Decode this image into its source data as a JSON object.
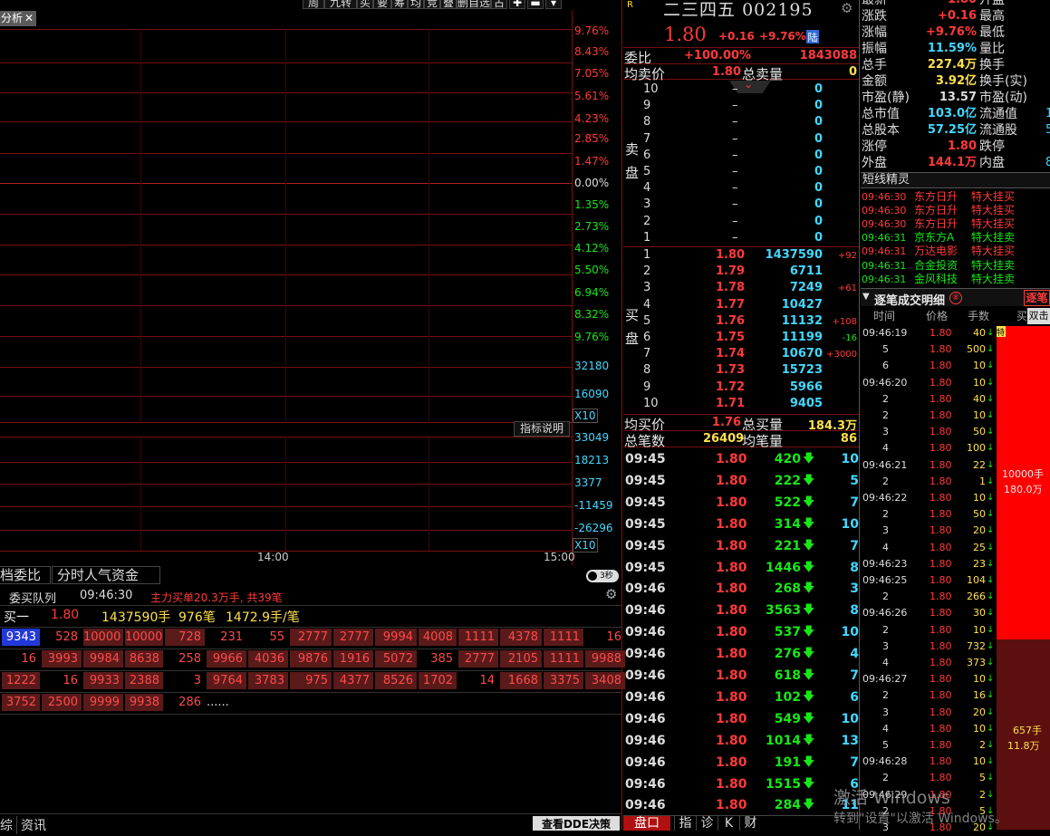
{
  "top_tabs": [
    "分析",
    "周",
    "九转",
    "买",
    "要",
    "筹",
    "均",
    "竞",
    "叠",
    "删自选",
    "占"
  ],
  "chart_tab": "分析",
  "pct_labels_red": [
    "9.76%",
    "8.43%",
    "7.05%",
    "5.61%",
    "4.23%",
    "2.85%",
    "1.47%"
  ],
  "pct_zero": "0.00%",
  "pct_labels_green": [
    "1.35%",
    "2.73%",
    "4.12%",
    "5.50%",
    "6.94%",
    "8.32%",
    "9.76%"
  ],
  "vol_labels": [
    "32180",
    "16090"
  ],
  "x10_a": "X10",
  "indicator_btn": "指标说明",
  "ind_labels": [
    {
      "v": "33049",
      "c": "cyan"
    },
    {
      "v": "18213",
      "c": "cyan"
    },
    {
      "v": "3377",
      "c": "cyan"
    },
    {
      "v": "-11459",
      "c": "cyan"
    },
    {
      "v": "-26296",
      "c": "cyan"
    }
  ],
  "x10_b": "X10",
  "time_labels": [
    "14:00",
    "15:00"
  ],
  "bottom_tabs": [
    "档委比",
    "分时人气资金"
  ],
  "queue": {
    "title": "委买队列",
    "time": "09:46:30",
    "note": "主力买单20.3万手, 共39笔",
    "buy1_label": "买一",
    "price": "1.80",
    "vol": "1437590手",
    "count": "976笔",
    "avg": "1472.9手/笔"
  },
  "queue_rows": [
    [
      "9343",
      "528",
      "10000",
      "10000",
      "728",
      "231",
      "55",
      "2777",
      "2777",
      "9994",
      "4008",
      "1111",
      "4378",
      "1111",
      "16"
    ],
    [
      "16",
      "3993",
      "9984",
      "8638",
      "258",
      "9966",
      "4036",
      "9876",
      "1916",
      "5072",
      "385",
      "2777",
      "2105",
      "1111",
      "9988"
    ],
    [
      "1222",
      "16",
      "9933",
      "2388",
      "3",
      "9764",
      "3783",
      "975",
      "4377",
      "8526",
      "1702",
      "14",
      "1668",
      "3375",
      "3408"
    ],
    [
      "3752",
      "2500",
      "9999",
      "9938",
      "286",
      "......"
    ]
  ],
  "stock": {
    "name": "二三四五",
    "code": "002195",
    "price": "1.80",
    "change": "+0.16",
    "pct": "+9.76%",
    "badge": "陆",
    "r": "R"
  },
  "weibi": {
    "label": "委比",
    "pct": "+100.00%",
    "value": "1843088"
  },
  "avg_sell": {
    "label": "均卖价",
    "value": "1.80",
    "total_label": "总卖量",
    "total": "0"
  },
  "sell_label": [
    "卖",
    "盘"
  ],
  "sell_rows": [
    [
      "10",
      "–",
      "0"
    ],
    [
      "9",
      "–",
      "0"
    ],
    [
      "8",
      "–",
      "0"
    ],
    [
      "7",
      "–",
      "0"
    ],
    [
      "6",
      "–",
      "0"
    ],
    [
      "5",
      "–",
      "0"
    ],
    [
      "4",
      "–",
      "0"
    ],
    [
      "3",
      "–",
      "0"
    ],
    [
      "2",
      "–",
      "0"
    ],
    [
      "1",
      "–",
      "0"
    ]
  ],
  "buy_label": [
    "买",
    "盘"
  ],
  "buy_rows": [
    [
      "1",
      "1.80",
      "1437590",
      "+92"
    ],
    [
      "2",
      "1.79",
      "6711",
      ""
    ],
    [
      "3",
      "1.78",
      "7249",
      "+61"
    ],
    [
      "4",
      "1.77",
      "10427",
      ""
    ],
    [
      "5",
      "1.76",
      "11132",
      "+108"
    ],
    [
      "6",
      "1.75",
      "11199",
      "-16"
    ],
    [
      "7",
      "1.74",
      "10670",
      "+3000"
    ],
    [
      "8",
      "1.73",
      "15723",
      ""
    ],
    [
      "9",
      "1.72",
      "5966",
      ""
    ],
    [
      "10",
      "1.71",
      "9405",
      ""
    ]
  ],
  "avg_buy": {
    "label": "均买价",
    "value": "1.76",
    "total_label": "总买量",
    "total": "184.3万"
  },
  "total_count": {
    "label": "总笔数",
    "value": "26409",
    "avg_label": "均笔量",
    "avg": "86"
  },
  "ticks": [
    [
      "09:45",
      "1.80",
      "420",
      "10"
    ],
    [
      "09:45",
      "1.80",
      "222",
      "5"
    ],
    [
      "09:45",
      "1.80",
      "522",
      "7"
    ],
    [
      "09:45",
      "1.80",
      "314",
      "10"
    ],
    [
      "09:45",
      "1.80",
      "221",
      "7"
    ],
    [
      "09:45",
      "1.80",
      "1446",
      "8"
    ],
    [
      "09:46",
      "1.80",
      "268",
      "3"
    ],
    [
      "09:46",
      "1.80",
      "3563",
      "8"
    ],
    [
      "09:46",
      "1.80",
      "537",
      "10"
    ],
    [
      "09:46",
      "1.80",
      "276",
      "4"
    ],
    [
      "09:46",
      "1.80",
      "618",
      "7"
    ],
    [
      "09:46",
      "1.80",
      "102",
      "6"
    ],
    [
      "09:46",
      "1.80",
      "549",
      "10"
    ],
    [
      "09:46",
      "1.80",
      "1014",
      "13"
    ],
    [
      "09:46",
      "1.80",
      "191",
      "7"
    ],
    [
      "09:46",
      "1.80",
      "1515",
      "6"
    ],
    [
      "09:46",
      "1.80",
      "284",
      "11"
    ]
  ],
  "mid_tabs": [
    "盘口",
    "指",
    "诊",
    "K",
    "财"
  ],
  "stats": [
    [
      "最新",
      "1.80",
      "升盘",
      ""
    ],
    [
      "涨跌",
      "+0.16",
      "最高",
      ""
    ],
    [
      "涨幅",
      "+9.76%",
      "最低",
      ""
    ],
    [
      "振幅",
      "11.59%",
      "量比",
      ""
    ],
    [
      "总手",
      "227.4万",
      "换手",
      ""
    ],
    [
      "金额",
      "3.92亿",
      "换手(实)",
      ""
    ],
    [
      "市盈(静)",
      "13.57",
      "市盈(动)",
      ""
    ],
    [
      "总市值",
      "103.0亿",
      "流通值",
      "1"
    ],
    [
      "总股本",
      "57.25亿",
      "流通股",
      "5"
    ],
    [
      "涨停",
      "1.80",
      "跌停",
      ""
    ],
    [
      "外盘",
      "144.1万",
      "内盘",
      "8"
    ]
  ],
  "news_title": "短线精灵",
  "news": [
    [
      "09:46:30",
      "东方日升",
      "特大挂买",
      "red"
    ],
    [
      "09:46:30",
      "东方日升",
      "特大挂买",
      "red"
    ],
    [
      "09:46:30",
      "东方日升",
      "特大挂买",
      "red"
    ],
    [
      "09:46:31",
      "京东方A",
      "特大挂卖",
      "green"
    ],
    [
      "09:46:31",
      "万达电影",
      "特大挂买",
      "red"
    ],
    [
      "09:46:31",
      "合金投资",
      "特大挂卖",
      "green"
    ],
    [
      "09:46:31",
      "金风科技",
      "特大挂卖",
      "green"
    ]
  ],
  "detail": {
    "title": "逐笔成交明细",
    "btn": "逐笔",
    "dbl": "双击",
    "headers": [
      "时间",
      "价格",
      "手数",
      "买"
    ]
  },
  "detail_rows": [
    [
      "09:46:19",
      "1.80",
      "40"
    ],
    [
      "5",
      "1.80",
      "500"
    ],
    [
      "6",
      "1.80",
      "10"
    ],
    [
      "09:46:20",
      "1.80",
      "10"
    ],
    [
      "2",
      "1.80",
      "40"
    ],
    [
      "2",
      "1.80",
      "10"
    ],
    [
      "3",
      "1.80",
      "50"
    ],
    [
      "4",
      "1.80",
      "100"
    ],
    [
      "09:46:21",
      "1.80",
      "22"
    ],
    [
      "2",
      "1.80",
      "1"
    ],
    [
      "09:46:22",
      "1.80",
      "10"
    ],
    [
      "2",
      "1.80",
      "50"
    ],
    [
      "3",
      "1.80",
      "20"
    ],
    [
      "4",
      "1.80",
      "25"
    ],
    [
      "09:46:23",
      "1.80",
      "23"
    ],
    [
      "09:46:25",
      "1.80",
      "104"
    ],
    [
      "2",
      "1.80",
      "266"
    ],
    [
      "09:46:26",
      "1.80",
      "30"
    ],
    [
      "2",
      "1.80",
      "10"
    ],
    [
      "3",
      "1.80",
      "732"
    ],
    [
      "4",
      "1.80",
      "373"
    ],
    [
      "09:46:27",
      "1.80",
      "10"
    ],
    [
      "2",
      "1.80",
      "16"
    ],
    [
      "3",
      "1.80",
      "20"
    ],
    [
      "4",
      "1.80",
      "10"
    ],
    [
      "5",
      "1.80",
      "2"
    ],
    [
      "09:46:28",
      "1.80",
      "10"
    ],
    [
      "2",
      "1.80",
      "5"
    ],
    [
      "09:46:29",
      "1.80",
      "2"
    ],
    [
      "2",
      "1.80",
      "5"
    ],
    [
      "3",
      "1.80",
      "20"
    ]
  ],
  "bar": {
    "top_label": "10000手",
    "top_amt": "180.0万",
    "bot_label": "657手",
    "bot_amt": "11.8万",
    "top_tag": "特"
  },
  "footer_left": [
    "综",
    "资讯"
  ],
  "footer_btn": "查看DDE决策",
  "toggle": "3秒",
  "watermark": {
    "line1": "激活 Windows",
    "line2": "转到\"设置\"以激活 Windows。"
  }
}
